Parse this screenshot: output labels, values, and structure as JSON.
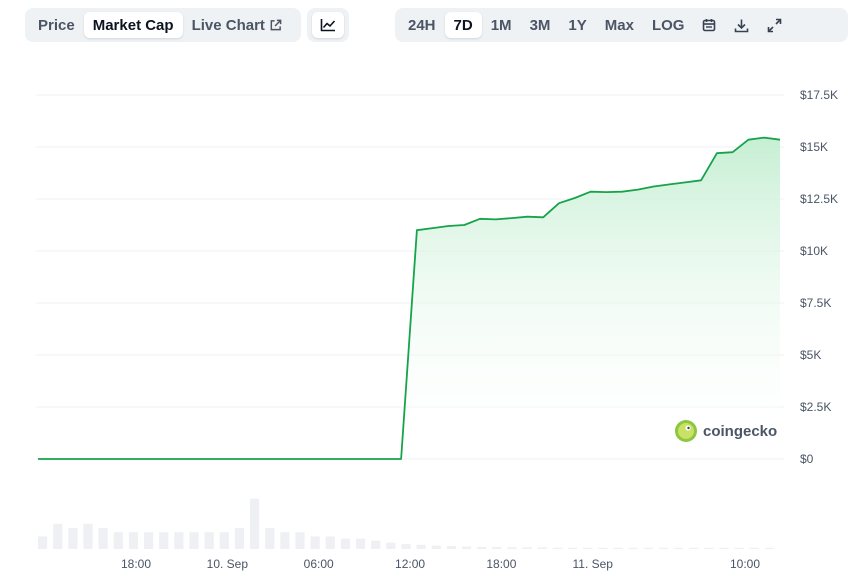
{
  "toolbar": {
    "metric_tabs": [
      {
        "label": "Price",
        "active": false
      },
      {
        "label": "Market Cap",
        "active": true
      },
      {
        "label": "Live Chart",
        "active": false
      }
    ],
    "chart_type_icon": "line-chart-icon",
    "ranges": [
      {
        "label": "24H",
        "active": false
      },
      {
        "label": "7D",
        "active": true
      },
      {
        "label": "1M",
        "active": false
      },
      {
        "label": "3M",
        "active": false
      },
      {
        "label": "1Y",
        "active": false
      },
      {
        "label": "Max",
        "active": false
      },
      {
        "label": "LOG",
        "active": false
      }
    ],
    "icons": [
      "calendar-icon",
      "download-icon",
      "expand-icon"
    ]
  },
  "watermark": "coingecko",
  "colors": {
    "line": "#16a34a",
    "area_top": "#c6efd3",
    "grid": "#eff2f5",
    "volume": "#eef0f3"
  },
  "chart_data": {
    "type": "area",
    "yticks": [
      {
        "label": "$0",
        "value": 0
      },
      {
        "label": "$2.5K",
        "value": 2500
      },
      {
        "label": "$5K",
        "value": 5000
      },
      {
        "label": "$7.5K",
        "value": 7500
      },
      {
        "label": "$10K",
        "value": 10000
      },
      {
        "label": "$12.5K",
        "value": 12500
      },
      {
        "label": "$15K",
        "value": 15000
      },
      {
        "label": "$17.5K",
        "value": 17500
      }
    ],
    "ylim": [
      0,
      17500
    ],
    "xlim": [
      0,
      62.3
    ],
    "xticks": [
      {
        "label": "18:00",
        "t": 11.8
      },
      {
        "label": "10. Sep",
        "t": 23.8
      },
      {
        "label": "06:00",
        "t": 35.8
      },
      {
        "label": "12:00",
        "t": 47.8
      },
      {
        "label": "18:00",
        "t": 59.8
      },
      {
        "label": "11. Sep",
        "t": 71.8
      },
      {
        "label": "10:00",
        "t": 91.8
      }
    ],
    "series": [
      {
        "points": [
          [
            0,
            0
          ],
          [
            46,
            0
          ],
          [
            48,
            11000
          ],
          [
            50,
            11100
          ],
          [
            52,
            11200
          ],
          [
            54,
            11250
          ],
          [
            56,
            11550
          ],
          [
            58,
            11520
          ],
          [
            60,
            11580
          ],
          [
            62,
            11650
          ],
          [
            64,
            11620
          ],
          [
            66,
            12300
          ],
          [
            68,
            12550
          ],
          [
            70,
            12850
          ],
          [
            72,
            12830
          ],
          [
            74,
            12850
          ],
          [
            76,
            12950
          ],
          [
            78,
            13100
          ],
          [
            80,
            13200
          ],
          [
            82,
            13300
          ],
          [
            84,
            13400
          ],
          [
            86,
            14700
          ],
          [
            88,
            14750
          ],
          [
            90,
            15350
          ],
          [
            92,
            15450
          ],
          [
            94,
            15350
          ]
        ]
      }
    ],
    "volume": [
      3,
      6,
      5,
      6,
      5,
      4,
      4,
      4,
      4,
      4,
      4,
      4,
      4,
      5,
      12,
      5,
      4,
      4,
      3,
      3,
      2.5,
      2.5,
      2,
      1.5,
      1.2,
      1.0,
      0.8,
      0.7,
      0.6,
      0.5,
      0.5,
      0.4,
      0.4,
      0.4,
      0.3,
      0.3,
      0.3,
      0.3,
      0.3,
      0.3,
      0.3,
      0.3,
      0.3,
      0.3,
      0.3,
      0.3,
      0.3,
      0.3,
      0.3
    ]
  }
}
